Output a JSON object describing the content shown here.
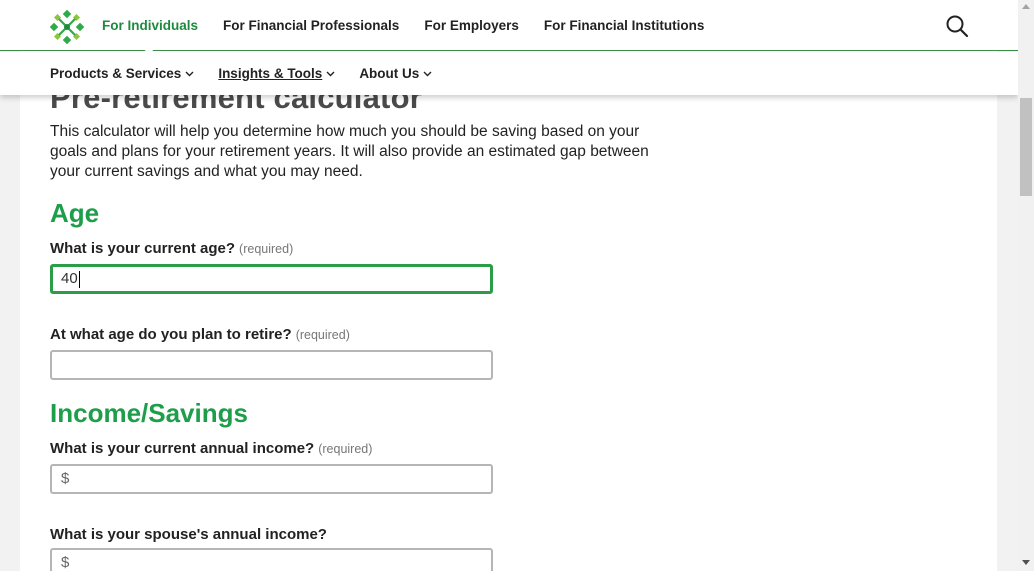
{
  "header": {
    "top_nav": [
      {
        "label": "For Individuals",
        "active": true
      },
      {
        "label": "For Financial Professionals",
        "active": false
      },
      {
        "label": "For Employers",
        "active": false
      },
      {
        "label": "For Financial Institutions",
        "active": false
      }
    ],
    "sub_nav": [
      {
        "label": "Products & Services"
      },
      {
        "label": "Insights & Tools"
      },
      {
        "label": "About Us"
      }
    ],
    "icons": {
      "logo": "brand-logo-icon",
      "search": "search-icon"
    },
    "colors": {
      "brand_green": "#1e9e4a",
      "focus_border": "#2b9c47"
    }
  },
  "main": {
    "title": "Pre-retirement calculator",
    "intro": "This calculator will help you determine how much you should be saving based on your goals and plans for your retirement years. It will also provide an estimated gap between your current savings and what you may need.",
    "sections": {
      "age": {
        "heading": "Age",
        "current_age": {
          "label": "What is your current age?",
          "required_note": "(required)",
          "value": "40"
        },
        "retire_age": {
          "label": "At what age do you plan to retire?",
          "required_note": "(required)",
          "value": ""
        }
      },
      "income": {
        "heading": "Income/Savings",
        "annual_income": {
          "label": "What is your current annual income?",
          "required_note": "(required)",
          "prefix": "$",
          "value": ""
        },
        "spouse_income": {
          "label": "What is your spouse's annual income?",
          "prefix": "$",
          "value": ""
        }
      }
    }
  }
}
